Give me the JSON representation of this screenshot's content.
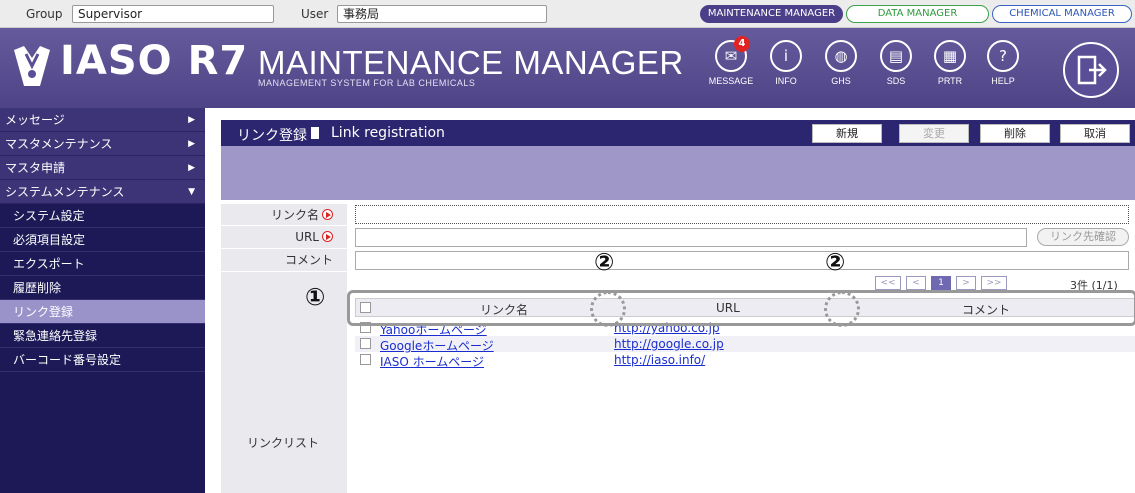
{
  "topbar": {
    "group_label": "Group",
    "group_value": "Supervisor",
    "user_label": "User",
    "user_value": "事務局",
    "managers": [
      "MAINTENANCE MANAGER",
      "DATA MANAGER",
      "CHEMICAL MANAGER"
    ]
  },
  "header": {
    "logo": "IASO R7",
    "title": "MAINTENANCE MANAGER",
    "subtitle": "MANAGEMENT SYSTEM FOR LAB CHEMICALS",
    "icons": [
      {
        "name": "MESSAGE",
        "glyph": "✉",
        "badge": "4"
      },
      {
        "name": "INFO",
        "glyph": "i"
      },
      {
        "name": "GHS",
        "glyph": "◍"
      },
      {
        "name": "SDS",
        "glyph": "▤"
      },
      {
        "name": "PRTR",
        "glyph": "▦"
      },
      {
        "name": "HELP",
        "glyph": "?"
      }
    ]
  },
  "sidebar": {
    "top_items": [
      {
        "label": "メッセージ",
        "arrow": "▶"
      },
      {
        "label": "マスタメンテナンス",
        "arrow": "▶"
      },
      {
        "label": "マスタ申請",
        "arrow": "▶"
      },
      {
        "label": "システムメンテナンス",
        "arrow": "▼"
      }
    ],
    "sub_items": [
      "システム設定",
      "必須項目設定",
      "エクスポート",
      "履歴削除",
      "リンク登録",
      "緊急連絡先登録",
      "バーコード番号設定"
    ],
    "active_index": 4
  },
  "titlebar": {
    "title_jp": "リンク登録",
    "title_en": "Link registration",
    "buttons": {
      "new": "新規",
      "change": "変更",
      "delete": "削除",
      "cancel": "取消"
    }
  },
  "form": {
    "link_name_label": "リンク名",
    "url_label": "URL",
    "comment_label": "コメント",
    "link_name_value": "",
    "url_value": "",
    "comment_value": "",
    "confirm_button": "リンク先確認",
    "list_label": "リンクリスト"
  },
  "pager": {
    "first": "<<",
    "prev": "<",
    "page": "1",
    "next": ">",
    "last": ">>",
    "count": "3件 (1/1)"
  },
  "table": {
    "headers": [
      "リンク名",
      "URL",
      "コメント"
    ],
    "rows": [
      {
        "name": "Yahooホームページ",
        "url": "http://yahoo.co.jp"
      },
      {
        "name": "Googleホームページ",
        "url": "http://google.co.jp"
      },
      {
        "name": "IASO ホームページ",
        "url": "http://iaso.info/"
      }
    ]
  },
  "annotations": {
    "one": "①",
    "two": "②"
  }
}
